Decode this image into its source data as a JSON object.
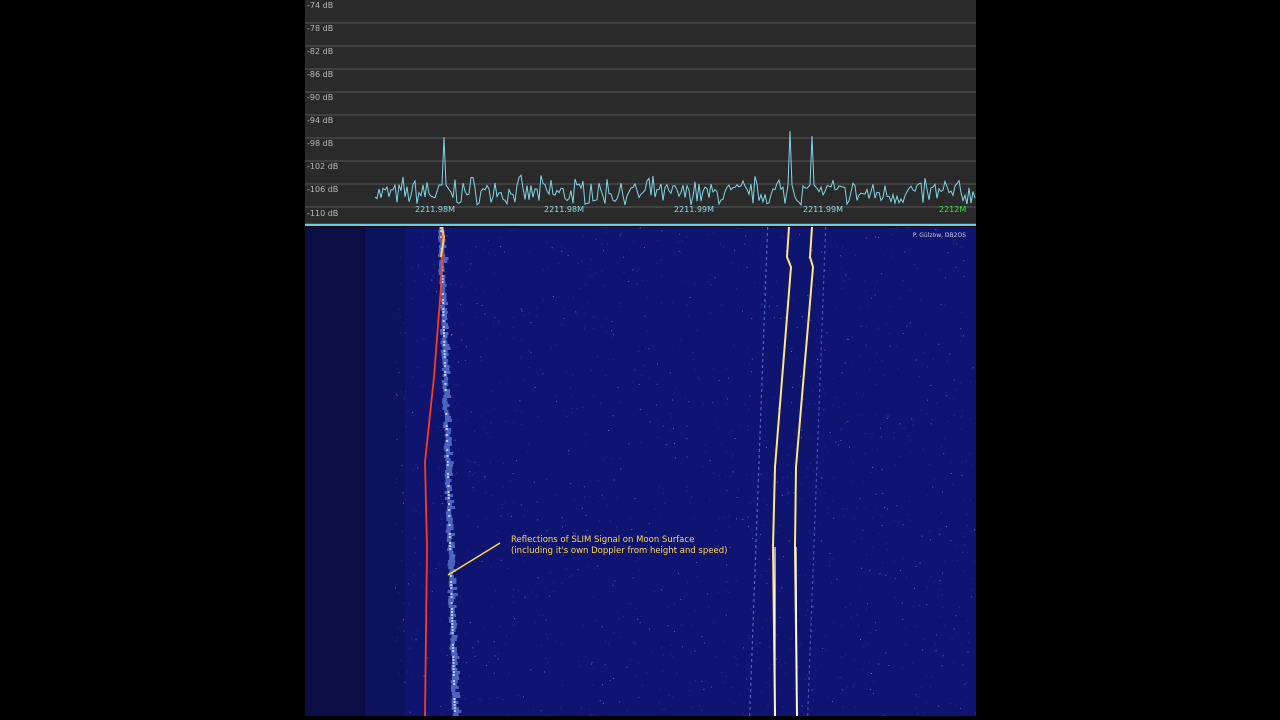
{
  "spectrum": {
    "db_labels": [
      "-74 dB",
      "-78 dB",
      "-82 dB",
      "-86 dB",
      "-90 dB",
      "-94 dB",
      "-98 dB",
      "-102 dB",
      "-106 dB",
      "-110 dB"
    ],
    "freq_labels": [
      "2211.98M",
      "2211.98M",
      "2211.99M",
      "2211.99M",
      "2212M"
    ],
    "trace_color": "#7fd6e8",
    "grid_color": "#555555",
    "baseline_color": "#5fd0f0",
    "freq_label_color": "#8fd8ea",
    "freq_label_highlight_color": "#3ee43e"
  },
  "waterfall": {
    "credit": "P. Gülzow, DB2OS",
    "background_color": "#0f1470",
    "annotation": {
      "line1": "Reflections of SLIM Signal on Moon Surface",
      "line2": "(including it's own Doppler from height and speed)",
      "color": "#ffd84a"
    }
  }
}
